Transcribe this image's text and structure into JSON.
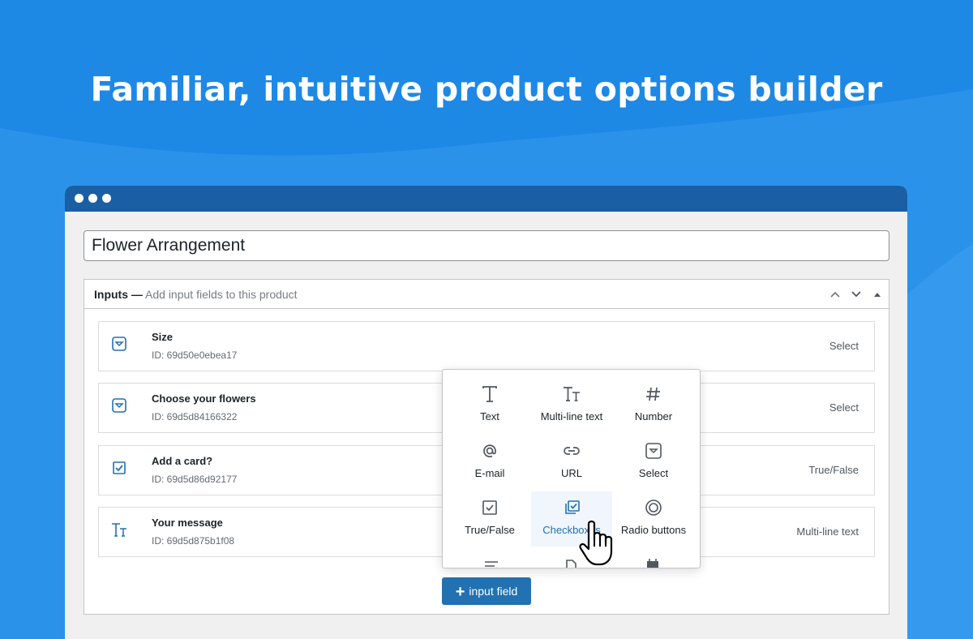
{
  "headline": "Familiar, intuitive product options builder",
  "product_title": "Flower Arrangement",
  "panel": {
    "title": "Inputs —",
    "subtitle": "Add input fields to this product"
  },
  "inputs": [
    {
      "name": "Size",
      "id": "ID: 69d50e0ebea17",
      "type": "Select",
      "icon": "select-icon"
    },
    {
      "name": "Choose your flowers",
      "id": "ID: 69d5d84166322",
      "type": "Select",
      "icon": "select-icon"
    },
    {
      "name": "Add a card?",
      "id": "ID: 69d5d86d92177",
      "type": "True/False",
      "icon": "checkbox-icon"
    },
    {
      "name": "Your message",
      "id": "ID: 69d5d875b1f08",
      "type": "Multi-line text",
      "icon": "multiline-text-icon"
    }
  ],
  "add_button": "input field",
  "field_types": [
    {
      "label": "Text",
      "icon": "text-icon"
    },
    {
      "label": "Multi-line text",
      "icon": "multiline-text-icon"
    },
    {
      "label": "Number",
      "icon": "hash-icon"
    },
    {
      "label": "E-mail",
      "icon": "at-icon"
    },
    {
      "label": "URL",
      "icon": "link-icon"
    },
    {
      "label": "Select",
      "icon": "select-icon"
    },
    {
      "label": "True/False",
      "icon": "checkbox-icon"
    },
    {
      "label": "Checkboxes",
      "icon": "checkboxes-icon"
    },
    {
      "label": "Radio buttons",
      "icon": "radio-icon"
    }
  ],
  "colors": {
    "background": "#1e88e5",
    "titlebar": "#1a5fa3",
    "accent": "#2271b1"
  }
}
